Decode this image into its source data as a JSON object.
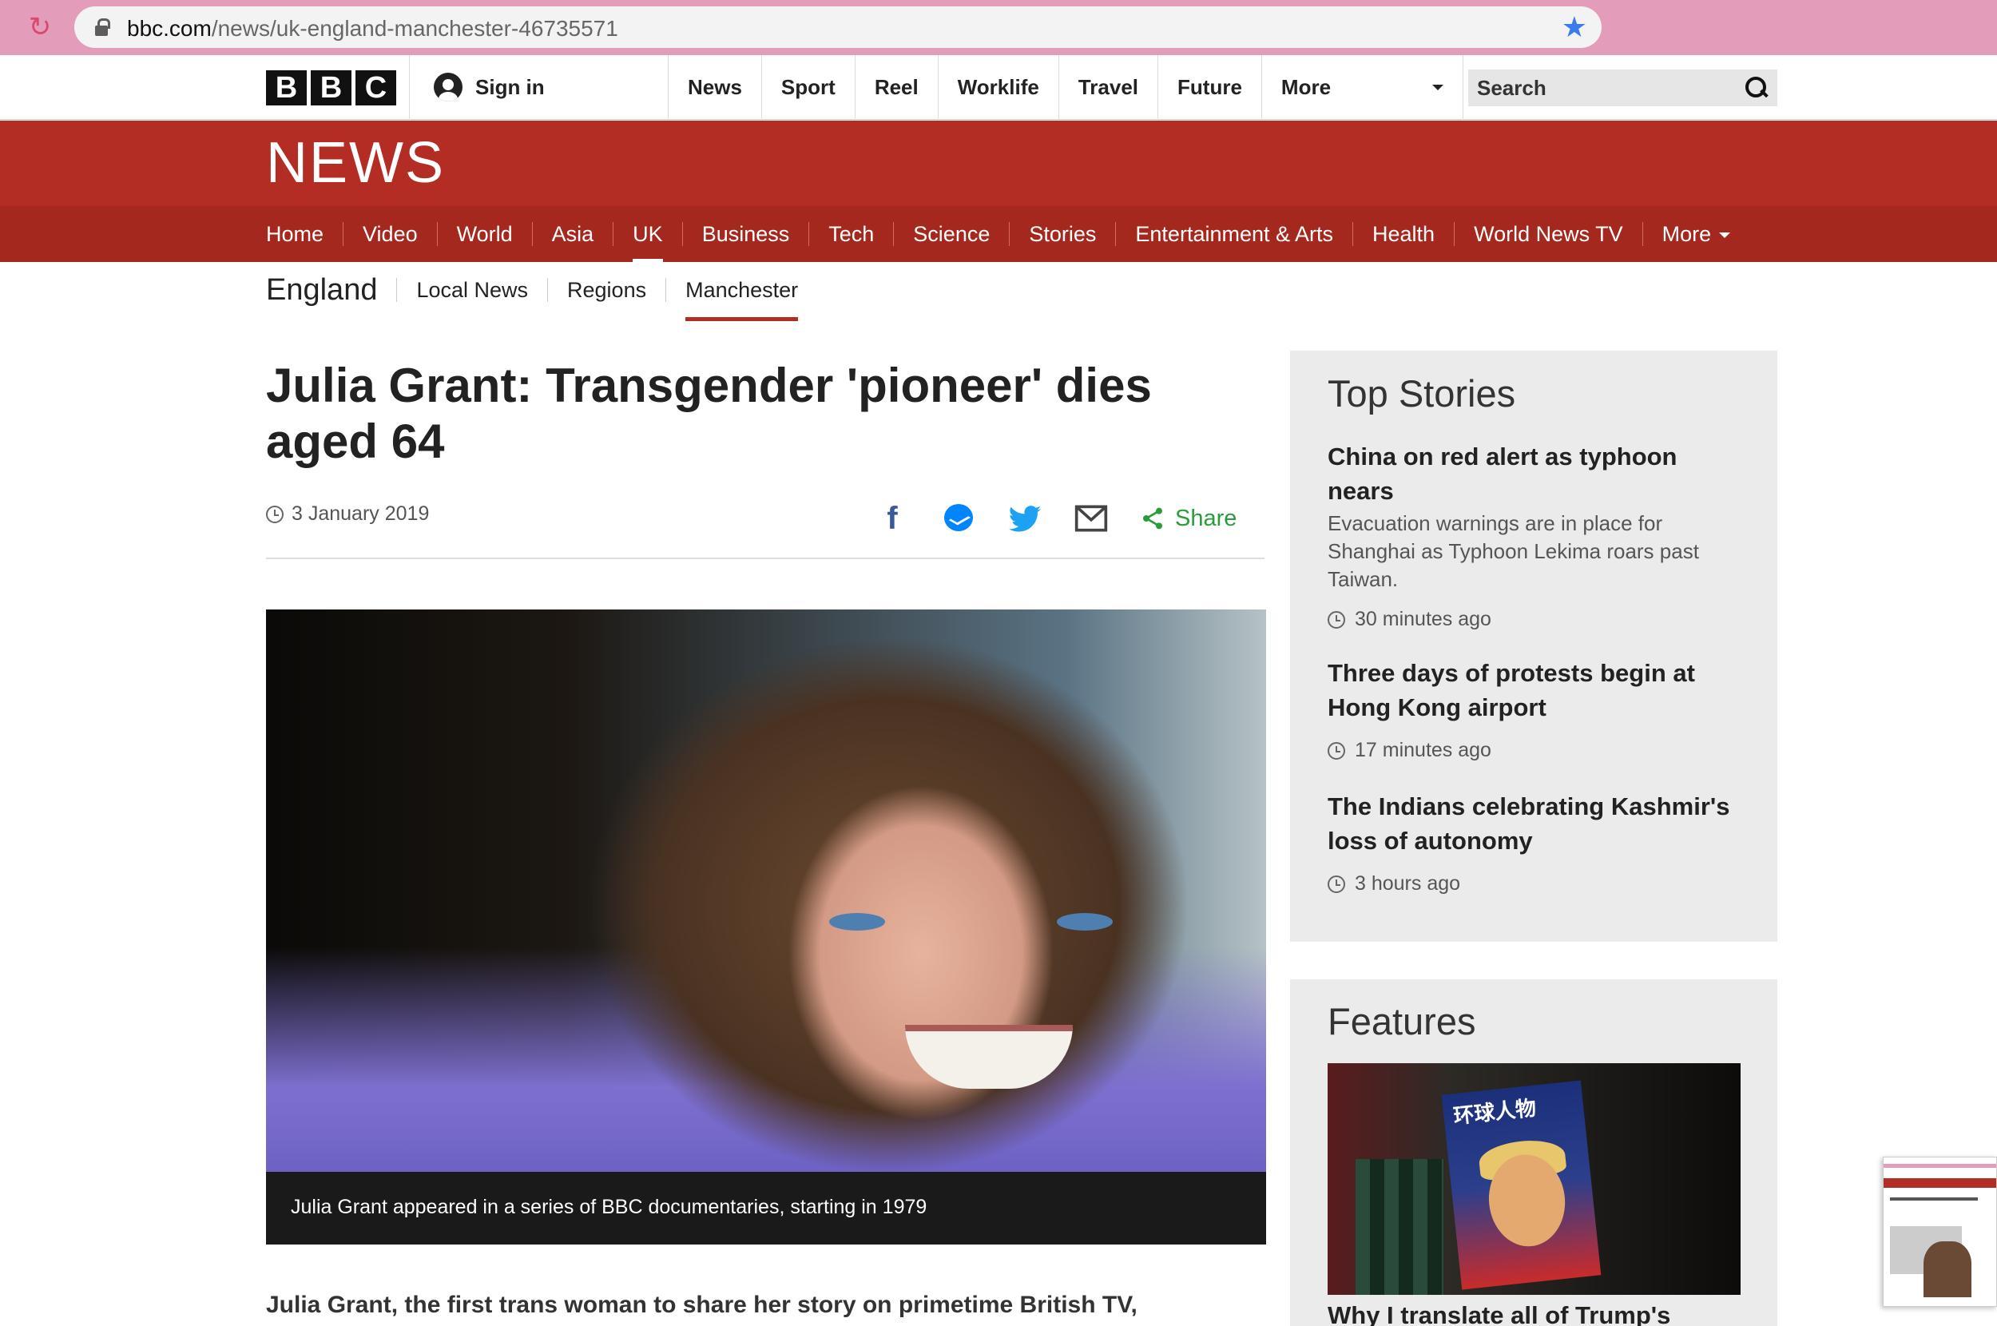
{
  "browser": {
    "url_host": "bbc.com",
    "url_path": "/news/uk-england-manchester-46735571"
  },
  "global_nav": {
    "logo_letters": [
      "B",
      "B",
      "C"
    ],
    "sign_in": "Sign in",
    "links": [
      "News",
      "Sport",
      "Reel",
      "Worklife",
      "Travel",
      "Future"
    ],
    "more": "More",
    "search_placeholder": "Search"
  },
  "news_banner": {
    "logo": "NEWS",
    "sections": [
      "Home",
      "Video",
      "World",
      "Asia",
      "UK",
      "Business",
      "Tech",
      "Science",
      "Stories",
      "Entertainment & Arts",
      "Health",
      "World News TV"
    ],
    "active_section": "UK",
    "more": "More"
  },
  "sub_nav": {
    "region": "England",
    "items": [
      "Local News",
      "Regions",
      "Manchester"
    ],
    "active": "Manchester"
  },
  "article": {
    "headline": "Julia Grant: Transgender 'pioneer' dies aged 64",
    "date": "3 January 2019",
    "share_label": "Share",
    "image_caption": "Julia Grant appeared in a series of BBC documentaries, starting in 1979",
    "lede": "Julia Grant, the first trans woman to share her story on primetime British TV,"
  },
  "top_stories": {
    "title": "Top Stories",
    "items": [
      {
        "title": "China on red alert as typhoon nears",
        "summary": "Evacuation warnings are in place for Shanghai as Typhoon Lekima roars past Taiwan.",
        "time": "30 minutes ago"
      },
      {
        "title": "Three days of protests begin at Hong Kong airport",
        "summary": "",
        "time": "17 minutes ago"
      },
      {
        "title": "The Indians celebrating Kashmir's loss of autonomy",
        "summary": "",
        "time": "3 hours ago"
      }
    ]
  },
  "features": {
    "title": "Features",
    "image_text": "环球人物",
    "item_title": "Why I translate all of Trump's"
  },
  "colors": {
    "chrome": "#e39cba",
    "bbc_red": "#b32d24",
    "share_green": "#2b9c3b",
    "facebook": "#3b5998",
    "twitter": "#1da1f2"
  }
}
